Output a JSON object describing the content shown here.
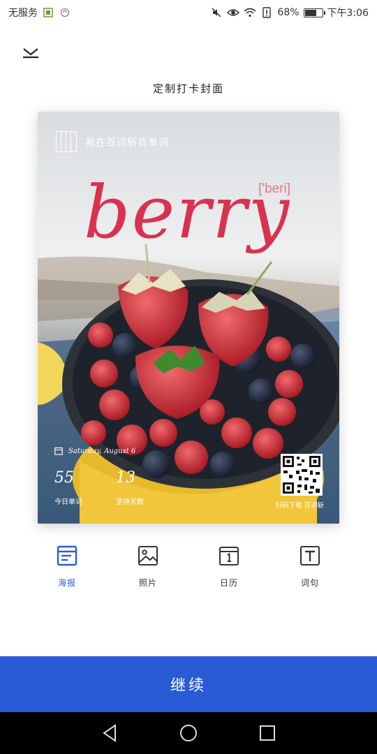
{
  "status_bar": {
    "carrier": "无服务",
    "battery_percent": "68%",
    "battery_level": 0.68,
    "time": "下午3:06"
  },
  "header": {
    "title": "定制打卡封面"
  },
  "poster": {
    "brand_text": "我在百词斩背单词",
    "word": "berry",
    "phonetic": "['beri]",
    "date": "Saturday, August 6",
    "words_today": "55",
    "words_today_label": "今日单词",
    "streak_days": "13",
    "streak_days_label": "坚持天数",
    "qr_caption": "扫码下载 百词斩",
    "colors": {
      "word": "#d8324f",
      "phonetic": "#e07a88"
    }
  },
  "tabs": [
    {
      "label": "海报",
      "icon": "poster-icon",
      "active": true
    },
    {
      "label": "照片",
      "icon": "image-icon",
      "active": false
    },
    {
      "label": "日历",
      "icon": "calendar-icon",
      "active": false
    },
    {
      "label": "词句",
      "icon": "text-icon",
      "active": false
    }
  ],
  "continue_button": {
    "label": "继续",
    "color": "#2a5bd7"
  }
}
